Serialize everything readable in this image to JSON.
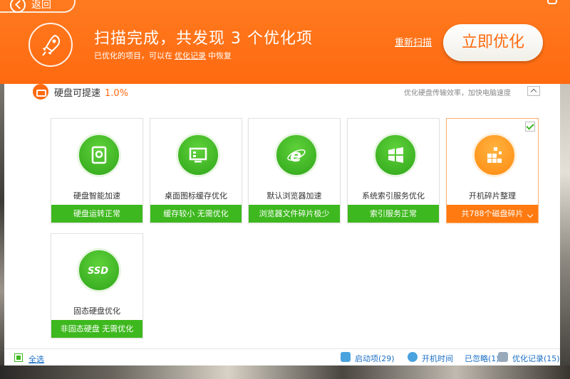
{
  "header": {
    "back_label": "返回",
    "title": "扫描完成，共发现 3 个优化项",
    "subtitle_prefix": "已优化的项目，可以在",
    "subtitle_link": "优化记录",
    "subtitle_suffix": "中恢复",
    "rescan_label": "重新扫描",
    "optimize_label": "立即优化"
  },
  "section": {
    "title": "硬盘可提速",
    "percent": "1.0%",
    "description": "优化硬盘传输效率，加快电脑速度"
  },
  "cards": [
    {
      "name": "硬盘智能加速",
      "status": "硬盘运转正常",
      "icon": "hard-disk-icon"
    },
    {
      "name": "桌面图标缓存优化",
      "status": "缓存较小 无需优化",
      "icon": "monitor-icon"
    },
    {
      "name": "默认浏览器加速",
      "status": "浏览器文件碎片极少",
      "icon": "ie-browser-icon"
    },
    {
      "name": "系统索引服务优化",
      "status": "索引服务正常",
      "icon": "windows-logo-icon"
    },
    {
      "name": "开机碎片整理",
      "status": "共788个磁盘碎片",
      "icon": "defrag-blocks-icon"
    },
    {
      "name": "固态硬盘优化",
      "status": "非固态硬盘 无需优化",
      "icon": "ssd-icon",
      "icon_text": "SSD"
    }
  ],
  "footer": {
    "select_all": "全选",
    "startup_items": "启动项(29)",
    "boot_time": "开机时间",
    "ignored": "已忽略(1)",
    "history": "优化记录(15)"
  },
  "colors": {
    "header_orange": "#ff6a10",
    "status_green": "#3db81e",
    "link_blue": "#1a6fc4"
  }
}
